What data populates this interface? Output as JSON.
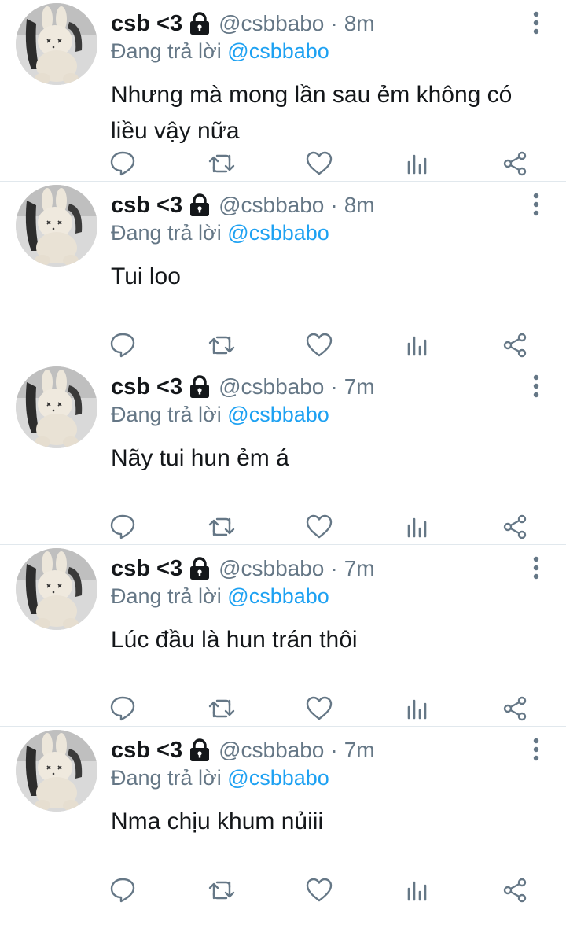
{
  "colors": {
    "text": "#14171a",
    "secondary": "#657786",
    "link": "#1da1f2",
    "divider": "#e1e8ed"
  },
  "tweets": [
    {
      "display_name": "csb <3",
      "handle": "@csbbabo",
      "separator": "·",
      "time": "8m",
      "replying_prefix": "Đang trả lời",
      "replying_to": "@csbbabo",
      "text": "Nhưng mà mong lần sau ẻm không có liều vậy nữa"
    },
    {
      "display_name": "csb <3",
      "handle": "@csbbabo",
      "separator": "·",
      "time": "8m",
      "replying_prefix": "Đang trả lời",
      "replying_to": "@csbbabo",
      "text": "Tui loo"
    },
    {
      "display_name": "csb <3",
      "handle": "@csbbabo",
      "separator": "·",
      "time": "7m",
      "replying_prefix": "Đang trả lời",
      "replying_to": "@csbbabo",
      "text": "Nãy tui hun ẻm á"
    },
    {
      "display_name": "csb <3",
      "handle": "@csbbabo",
      "separator": "·",
      "time": "7m",
      "replying_prefix": "Đang trả lời",
      "replying_to": "@csbbabo",
      "text": "Lúc đầu là hun trán thôi"
    },
    {
      "display_name": "csb <3",
      "handle": "@csbbabo",
      "separator": "·",
      "time": "7m",
      "replying_prefix": "Đang trả lời",
      "replying_to": "@csbbabo",
      "text": "Nma chịu khum nủiii"
    }
  ],
  "icons": {
    "lock": "lock-icon",
    "more": "more-vertical-icon",
    "reply": "reply-icon",
    "retweet": "retweet-icon",
    "like": "heart-icon",
    "analytics": "analytics-icon",
    "share": "share-icon"
  }
}
